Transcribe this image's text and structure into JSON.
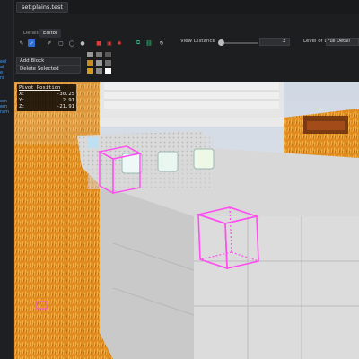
{
  "app": {
    "file_tab": "set:plains.test"
  },
  "left_panel": {
    "fragments": [
      "eel",
      "al",
      "e",
      "rs",
      "em",
      "em",
      "ram"
    ]
  },
  "tabs": [
    {
      "label": "Details"
    },
    {
      "label": "Editor",
      "active": true
    }
  ],
  "toolbar": {
    "tools": [
      {
        "icon": "pencil-icon",
        "glyph": "✎",
        "color": "#bdbdbd"
      },
      {
        "icon": "cursor-icon",
        "glyph": "➶",
        "color": "#ffffff",
        "selected": true
      },
      {
        "icon": "brush-icon",
        "glyph": "✐",
        "color": "#bdbdbd"
      },
      {
        "icon": "square-select-icon",
        "glyph": "▢",
        "color": "#bdbdbd"
      },
      {
        "icon": "circle-select-icon",
        "glyph": "◯",
        "color": "#bdbdbd"
      },
      {
        "icon": "sphere-icon",
        "glyph": "●",
        "color": "#bdbdbd"
      },
      {
        "icon": "fill-red-icon",
        "glyph": "■",
        "color": "#e03a3a"
      },
      {
        "icon": "box-red-icon",
        "glyph": "▣",
        "color": "#e03a3a"
      },
      {
        "icon": "gear-red-icon",
        "glyph": "✱",
        "color": "#e03a3a"
      },
      {
        "icon": "copy-green-icon",
        "glyph": "⧉",
        "color": "#2fc07a"
      },
      {
        "icon": "link-green-icon",
        "glyph": "⛓",
        "color": "#2fc07a"
      },
      {
        "icon": "rotate-icon",
        "glyph": "↻",
        "color": "#bdbdbd"
      }
    ],
    "view_distance_label": "View Distance",
    "view_distance_value": "3",
    "view_distance_fraction": 0.05,
    "level_of_detail_label": "Level of Detail",
    "level_of_detail_value": "Full Detail"
  },
  "actions": {
    "add_block": "Add Block",
    "delete_selected": "Delete Selected"
  },
  "palette": {
    "row1": [
      "#9a9a9a",
      "#7a7a7a",
      "#595959"
    ],
    "row2": [
      "#c98a22",
      "#9a9a9a",
      "#6f6f6f"
    ],
    "row3": [
      "#d69a1e",
      "#8a8a8a",
      "#ffffff"
    ]
  },
  "pivot": {
    "title": "Pivot Position",
    "rows": [
      {
        "axis": "X:",
        "value": "-30.25"
      },
      {
        "axis": "Y:",
        "value": "2.91"
      },
      {
        "axis": "Z:",
        "value": "-21.91"
      }
    ]
  },
  "colors": {
    "accent": "#2d6fd6",
    "selection": "#ff4df0",
    "grass": "#e08a1e"
  }
}
